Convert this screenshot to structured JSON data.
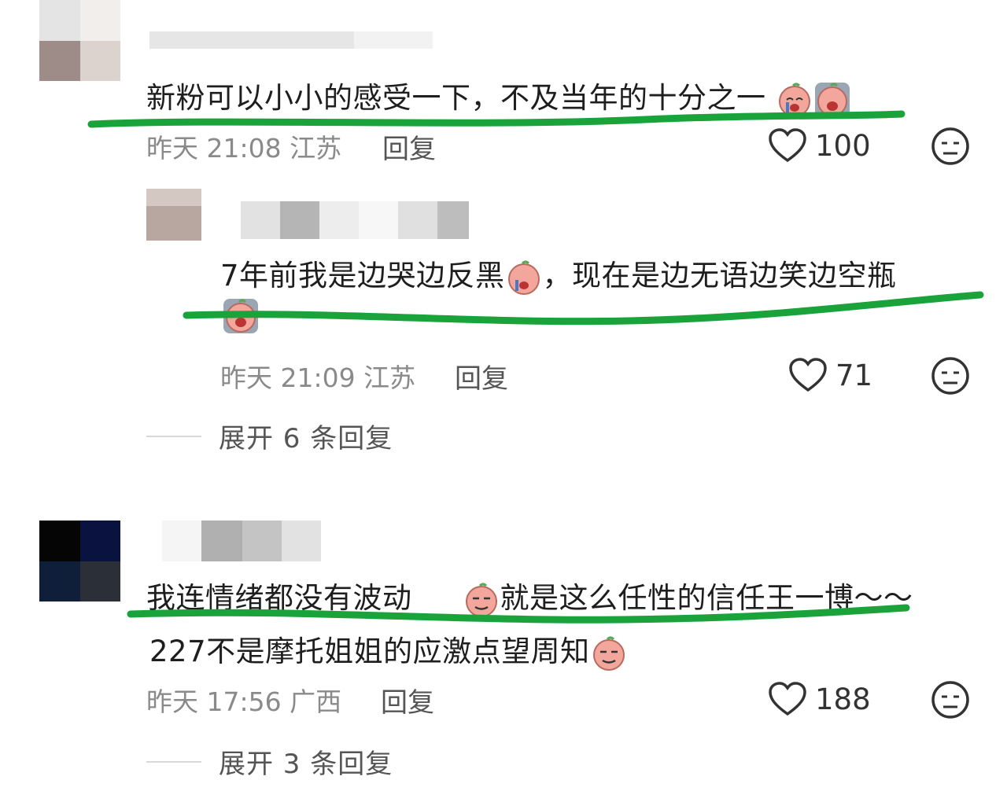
{
  "comments": [
    {
      "text": "新粉可以小小的感受一下，不及当年的十分之一",
      "time": "昨天 21:08",
      "location": "江苏",
      "reply_label": "回复",
      "likes": "100"
    },
    {
      "text": "7年前我是边哭边反黑",
      "text_tail": "，现在是边无语边笑边空瓶",
      "time": "昨天 21:09",
      "location": "江苏",
      "reply_label": "回复",
      "likes": "71",
      "expand_label": "展开 6 条回复"
    },
    {
      "text": "我连情绪都没有波动",
      "text_tail": "就是这么任性的信任王一博～～",
      "line2": "227不是摩托姐姐的应激点望周知",
      "time": "昨天 17:56",
      "location": "广西",
      "reply_label": "回复",
      "likes": "188",
      "expand_label": "展开 3 条回复"
    }
  ],
  "colors": {
    "underline": "#1aa33a",
    "emoji_face": "#f3a69b",
    "emoji_tear": "#4a78c8"
  },
  "icons": [
    "heart-icon",
    "dislike-face-icon",
    "crying-emoji",
    "smirk-emoji"
  ]
}
